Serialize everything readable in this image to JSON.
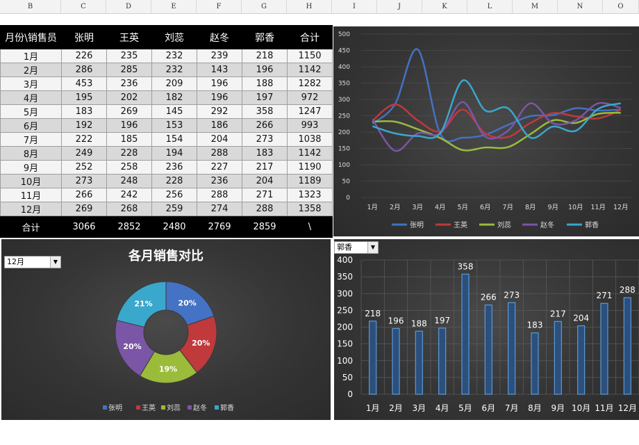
{
  "columns": [
    "B",
    "C",
    "D",
    "E",
    "F",
    "G",
    "H",
    "I",
    "J",
    "K",
    "L",
    "M",
    "N",
    "O"
  ],
  "table": {
    "headers": [
      "月份\\销售员",
      "张明",
      "王英",
      "刘蕊",
      "赵冬",
      "郭香",
      "合计"
    ],
    "rows": [
      [
        "1月",
        "226",
        "235",
        "232",
        "239",
        "218",
        "1150"
      ],
      [
        "2月",
        "286",
        "285",
        "232",
        "143",
        "196",
        "1142"
      ],
      [
        "3月",
        "453",
        "236",
        "209",
        "196",
        "188",
        "1282"
      ],
      [
        "4月",
        "195",
        "202",
        "182",
        "196",
        "197",
        "972"
      ],
      [
        "5月",
        "183",
        "269",
        "145",
        "292",
        "358",
        "1247"
      ],
      [
        "6月",
        "192",
        "196",
        "153",
        "186",
        "266",
        "993"
      ],
      [
        "7月",
        "222",
        "185",
        "154",
        "204",
        "273",
        "1038"
      ],
      [
        "8月",
        "249",
        "228",
        "194",
        "288",
        "183",
        "1142"
      ],
      [
        "9月",
        "252",
        "258",
        "236",
        "227",
        "217",
        "1190"
      ],
      [
        "10月",
        "273",
        "248",
        "228",
        "236",
        "204",
        "1189"
      ],
      [
        "11月",
        "266",
        "242",
        "256",
        "288",
        "271",
        "1323"
      ],
      [
        "12月",
        "269",
        "268",
        "259",
        "274",
        "288",
        "1358"
      ]
    ],
    "footer": [
      "合计",
      "3066",
      "2852",
      "2480",
      "2769",
      "2859",
      "\\"
    ]
  },
  "donut_panel": {
    "title": "各月销售对比",
    "selected_month": "12月"
  },
  "bar_panel": {
    "selected_person": "郭香"
  },
  "colors": {
    "张明": "#4472c4",
    "王英": "#c0393b",
    "刘蕊": "#9bbb3b",
    "赵冬": "#7b56a6",
    "郭香": "#3aa7cc"
  },
  "chart_data": [
    {
      "type": "line",
      "x": [
        "1月",
        "2月",
        "3月",
        "4月",
        "5月",
        "6月",
        "7月",
        "8月",
        "9月",
        "10月",
        "11月",
        "12月"
      ],
      "ylim": [
        0,
        500
      ],
      "yticks": [
        0,
        50,
        100,
        150,
        200,
        250,
        300,
        350,
        400,
        450,
        500
      ],
      "smooth": true,
      "series": [
        {
          "name": "张明",
          "values": [
            226,
            286,
            453,
            195,
            183,
            192,
            222,
            249,
            252,
            273,
            266,
            269
          ]
        },
        {
          "name": "王英",
          "values": [
            235,
            285,
            236,
            202,
            269,
            196,
            185,
            228,
            258,
            248,
            242,
            268
          ]
        },
        {
          "name": "刘蕊",
          "values": [
            232,
            232,
            209,
            182,
            145,
            153,
            154,
            194,
            236,
            228,
            256,
            259
          ]
        },
        {
          "name": "赵冬",
          "values": [
            239,
            143,
            196,
            196,
            292,
            186,
            204,
            288,
            227,
            236,
            288,
            274
          ]
        },
        {
          "name": "郭香",
          "values": [
            218,
            196,
            188,
            197,
            358,
            266,
            273,
            183,
            217,
            204,
            271,
            288
          ]
        }
      ],
      "legend": "bottom"
    },
    {
      "type": "pie",
      "title": "各月销售对比",
      "categories": [
        "张明",
        "王英",
        "刘蕊",
        "赵冬",
        "郭香"
      ],
      "values": [
        269,
        268,
        259,
        274,
        288
      ],
      "labels": [
        "20%",
        "20%",
        "19%",
        "20%",
        "21%"
      ],
      "legend": "bottom"
    },
    {
      "type": "bar",
      "categories": [
        "1月",
        "2月",
        "3月",
        "4月",
        "5月",
        "6月",
        "7月",
        "8月",
        "9月",
        "10月",
        "11月",
        "12月"
      ],
      "values": [
        218,
        196,
        188,
        197,
        358,
        266,
        273,
        183,
        217,
        204,
        271,
        288
      ],
      "ylim": [
        0,
        400
      ],
      "yticks": [
        0,
        50,
        100,
        150,
        200,
        250,
        300,
        350,
        400
      ],
      "grid": true
    }
  ]
}
